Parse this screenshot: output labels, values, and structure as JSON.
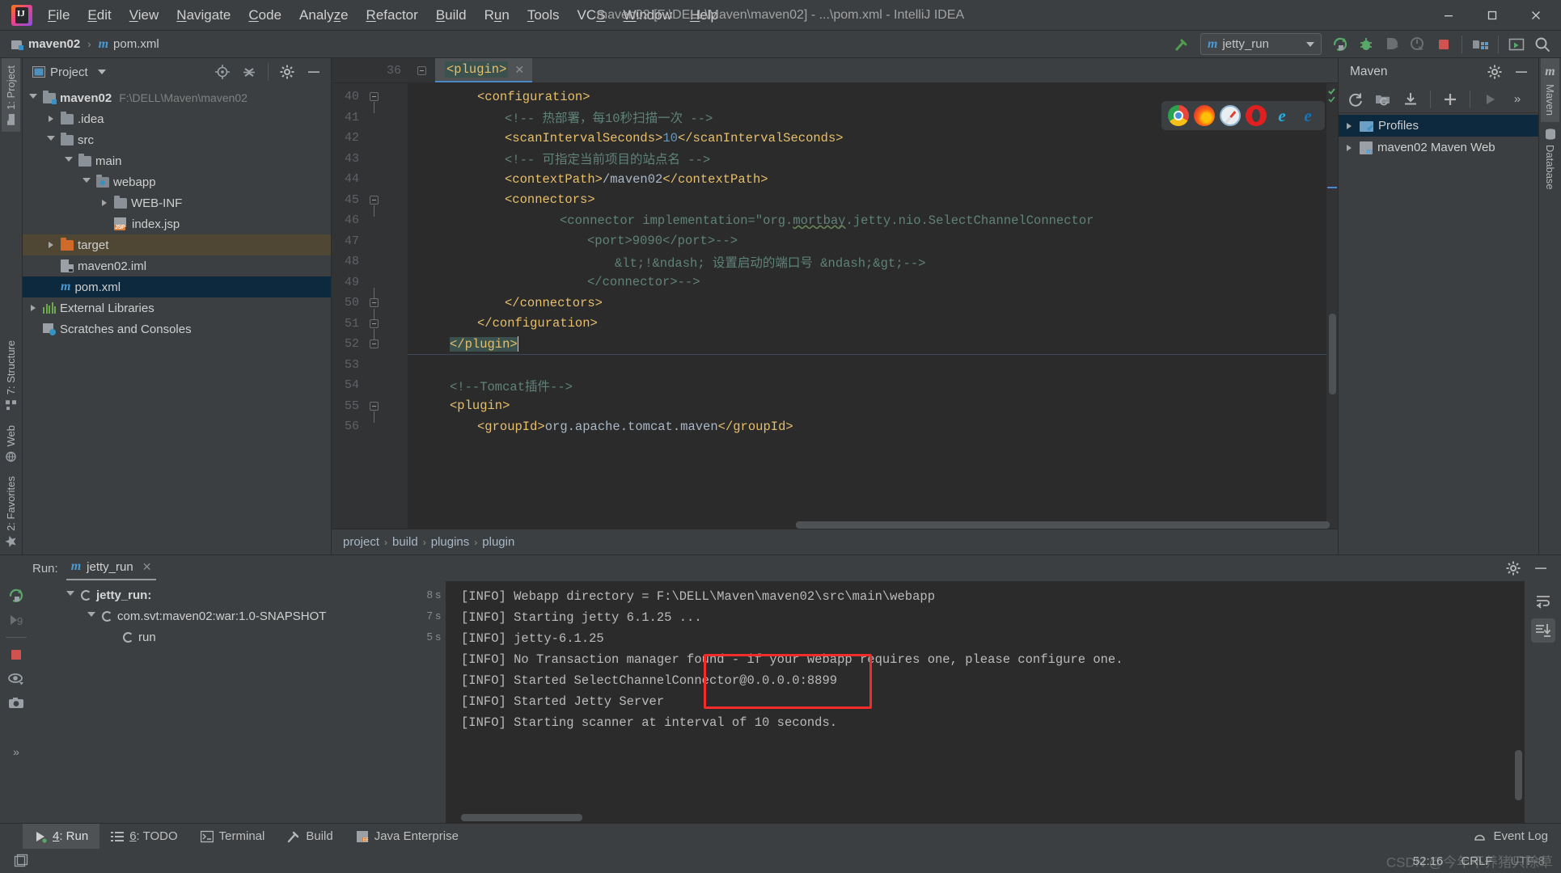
{
  "window": {
    "title": "maven02 [F:\\DELL\\Maven\\maven02] - ...\\pom.xml - IntelliJ IDEA",
    "minimize": "—",
    "maximize": "❐",
    "close": "✕"
  },
  "menubar": [
    {
      "label": "File",
      "mnemonic": "F"
    },
    {
      "label": "Edit",
      "mnemonic": "E"
    },
    {
      "label": "View",
      "mnemonic": "V"
    },
    {
      "label": "Navigate",
      "mnemonic": "N"
    },
    {
      "label": "Code",
      "mnemonic": "C"
    },
    {
      "label": "Analyze",
      "mnemonic": "z"
    },
    {
      "label": "Refactor",
      "mnemonic": "R"
    },
    {
      "label": "Build",
      "mnemonic": "B"
    },
    {
      "label": "Run",
      "mnemonic": "u"
    },
    {
      "label": "Tools",
      "mnemonic": "T"
    },
    {
      "label": "VCS",
      "mnemonic": "S"
    },
    {
      "label": "Window",
      "mnemonic": "W"
    },
    {
      "label": "Help",
      "mnemonic": "H"
    }
  ],
  "navbar": {
    "project": "maven02",
    "file": "pom.xml",
    "run_config": "jetty_run",
    "icons": [
      "build-hammer-icon",
      "run-icon",
      "debug-icon",
      "run-coverage-icon",
      "profile-icon",
      "stop-icon",
      "project-structure-icon",
      "web-preview-icon",
      "search-everywhere-icon"
    ]
  },
  "left_strip": [
    {
      "label": "1: Project",
      "active": true
    },
    {
      "label": "7: Structure",
      "active": false
    },
    {
      "label": "Web",
      "active": false
    },
    {
      "label": "2: Favorites",
      "active": false
    }
  ],
  "right_strip": [
    {
      "label": "Maven",
      "active": true
    },
    {
      "label": "Database",
      "active": false
    }
  ],
  "project_panel": {
    "title": "Project",
    "tree": [
      {
        "indent": 0,
        "arrow": "open",
        "icon": "module-icon",
        "label": "maven02",
        "bold": true,
        "path": "F:\\DELL\\Maven\\maven02",
        "selected": "none"
      },
      {
        "indent": 1,
        "arrow": "closed",
        "icon": "folder-icon",
        "label": ".idea",
        "bold": false,
        "path": "",
        "selected": "none"
      },
      {
        "indent": 1,
        "arrow": "open",
        "icon": "folder-icon",
        "label": "src",
        "bold": false,
        "path": "",
        "selected": "none"
      },
      {
        "indent": 2,
        "arrow": "open",
        "icon": "folder-icon",
        "label": "main",
        "bold": false,
        "path": "",
        "selected": "none"
      },
      {
        "indent": 3,
        "arrow": "open",
        "icon": "folder-web-icon",
        "label": "webapp",
        "bold": false,
        "path": "",
        "selected": "none"
      },
      {
        "indent": 4,
        "arrow": "closed",
        "icon": "folder-icon",
        "label": "WEB-INF",
        "bold": false,
        "path": "",
        "selected": "none"
      },
      {
        "indent": 4,
        "arrow": "none",
        "icon": "jsp-file-icon",
        "label": "index.jsp",
        "bold": false,
        "path": "",
        "selected": "none"
      },
      {
        "indent": 1,
        "arrow": "closed",
        "icon": "folder-excluded-icon",
        "label": "target",
        "bold": false,
        "path": "",
        "selected": "brown"
      },
      {
        "indent": 1,
        "arrow": "none",
        "icon": "iml-file-icon",
        "label": "maven02.iml",
        "bold": false,
        "path": "",
        "selected": "none"
      },
      {
        "indent": 1,
        "arrow": "none",
        "icon": "maven-file-icon",
        "label": "pom.xml",
        "bold": false,
        "path": "",
        "selected": "blue"
      },
      {
        "indent": 0,
        "arrow": "closed",
        "icon": "libraries-icon",
        "label": "External Libraries",
        "bold": false,
        "path": "",
        "selected": "none"
      },
      {
        "indent": 0,
        "arrow": "none",
        "icon": "scratches-icon",
        "label": "Scratches and Consoles",
        "bold": false,
        "path": "",
        "selected": "none"
      }
    ]
  },
  "editor": {
    "tab": "pom.xml",
    "tab_close": "✕",
    "sticky_line": {
      "number": "36",
      "text": "<plugin>"
    },
    "lines": [
      {
        "num": "40",
        "fold": "open",
        "comment_gutter": "",
        "indent": 4,
        "tokens": [
          {
            "t": "tag",
            "v": "<configuration>"
          }
        ]
      },
      {
        "num": "41",
        "fold": "none",
        "comment_gutter": "",
        "indent": 6,
        "tokens": [
          {
            "t": "cmt",
            "v": "<!-- 热部署，每10秒扫描一次 -->"
          }
        ]
      },
      {
        "num": "42",
        "fold": "none",
        "comment_gutter": "",
        "indent": 6,
        "tokens": [
          {
            "t": "tag",
            "v": "<scanIntervalSeconds>"
          },
          {
            "t": "num",
            "v": "10"
          },
          {
            "t": "tag",
            "v": "</scanIntervalSeconds>"
          }
        ]
      },
      {
        "num": "43",
        "fold": "none",
        "comment_gutter": "",
        "indent": 6,
        "tokens": [
          {
            "t": "cmt",
            "v": "<!-- 可指定当前项目的站点名 -->"
          }
        ]
      },
      {
        "num": "44",
        "fold": "none",
        "comment_gutter": "",
        "indent": 6,
        "tokens": [
          {
            "t": "tag",
            "v": "<contextPath>"
          },
          {
            "t": "text",
            "v": "/maven02"
          },
          {
            "t": "tag",
            "v": "</contextPath>"
          }
        ]
      },
      {
        "num": "45",
        "fold": "open",
        "comment_gutter": "",
        "indent": 6,
        "tokens": [
          {
            "t": "tag",
            "v": "<connectors>"
          }
        ]
      },
      {
        "num": "46",
        "fold": "none",
        "comment_gutter": "<!--",
        "indent": 10,
        "tokens": [
          {
            "t": "cmt",
            "v": "<connector implementation=\"org."
          },
          {
            "t": "cmt-wavy",
            "v": "mortbay"
          },
          {
            "t": "cmt",
            "v": ".jetty.nio.SelectChannelConnector"
          }
        ]
      },
      {
        "num": "47",
        "fold": "none",
        "comment_gutter": "<!--",
        "indent": 12,
        "tokens": [
          {
            "t": "cmt",
            "v": "<port>9090</port>-->"
          }
        ]
      },
      {
        "num": "48",
        "fold": "none",
        "comment_gutter": "<!--",
        "indent": 14,
        "tokens": [
          {
            "t": "cmt",
            "v": "&lt;!&ndash; 设置启动的端口号 &ndash;&gt;-->"
          }
        ]
      },
      {
        "num": "49",
        "fold": "none",
        "comment_gutter": "<!--",
        "indent": 12,
        "tokens": [
          {
            "t": "cmt",
            "v": "</connector>-->"
          }
        ]
      },
      {
        "num": "50",
        "fold": "close",
        "comment_gutter": "",
        "indent": 6,
        "tokens": [
          {
            "t": "tag",
            "v": "</connectors>"
          }
        ]
      },
      {
        "num": "51",
        "fold": "close",
        "comment_gutter": "",
        "indent": 4,
        "tokens": [
          {
            "t": "tag",
            "v": "</configuration>"
          }
        ]
      },
      {
        "num": "52",
        "fold": "close",
        "comment_gutter": "",
        "indent": 2,
        "tokens": [
          {
            "t": "tag-sel",
            "v": "</plugin>"
          },
          {
            "t": "caret",
            "v": ""
          }
        ]
      },
      {
        "num": "53",
        "fold": "none",
        "comment_gutter": "",
        "indent": 0,
        "tokens": []
      },
      {
        "num": "54",
        "fold": "none",
        "comment_gutter": "",
        "indent": 2,
        "tokens": [
          {
            "t": "cmt",
            "v": "<!--Tomcat插件-->"
          }
        ]
      },
      {
        "num": "55",
        "fold": "open",
        "comment_gutter": "",
        "indent": 2,
        "tokens": [
          {
            "t": "tag",
            "v": "<plugin>"
          }
        ]
      },
      {
        "num": "56",
        "fold": "none",
        "comment_gutter": "",
        "indent": 4,
        "tokens": [
          {
            "t": "tag",
            "v": "<groupId>"
          },
          {
            "t": "text",
            "v": "org.apache.tomcat.maven"
          },
          {
            "t": "tag",
            "v": "</groupId>"
          }
        ]
      }
    ],
    "browsers": [
      "chrome-icon",
      "firefox-icon",
      "safari-icon",
      "opera-icon",
      "ie-icon",
      "edge-icon"
    ],
    "breadcrumbs": [
      "project",
      "build",
      "plugins",
      "plugin"
    ],
    "breadcrumb_sep": "›"
  },
  "maven_panel": {
    "title": "Maven",
    "toolbar": [
      "reimport-icon",
      "generate-sources-icon",
      "download-sources-icon",
      "add-icon",
      "run-goal-icon",
      "more-icon"
    ],
    "tree": [
      {
        "label": "Profiles",
        "icon": "profiles-icon",
        "selected": true
      },
      {
        "label": "maven02 Maven Web",
        "icon": "maven-module-icon",
        "selected": false
      }
    ]
  },
  "run_panel": {
    "label": "Run:",
    "tab": "jetty_run",
    "tab_close": "✕",
    "gutter_icons": [
      "rerun-icon",
      "rerun-failed-icon",
      "stop-icon",
      "toggle-visibility-icon",
      "screenshot-icon",
      "expand-more-icon"
    ],
    "right_icons": [
      "settings-icon",
      "hide-icon",
      "soft-wrap-icon",
      "scroll-to-end-icon"
    ],
    "tree": [
      {
        "indent": 0,
        "arrow": "open",
        "label": "jetty_run:",
        "bold": true,
        "time": "8 s"
      },
      {
        "indent": 1,
        "arrow": "open",
        "label": "com.svt:maven02:war:1.0-SNAPSHOT",
        "bold": false,
        "time": "7 s"
      },
      {
        "indent": 2,
        "arrow": "none",
        "label": "run",
        "bold": false,
        "time": "5 s"
      }
    ],
    "console": [
      "[INFO] Webapp directory = F:\\DELL\\Maven\\maven02\\src\\main\\webapp",
      "[INFO] Starting jetty 6.1.25 ...",
      "[INFO] jetty-6.1.25",
      "[INFO] No Transaction manager found - if your webapp requires one, please configure one.",
      "[INFO] Started SelectChannelConnector@0.0.0.0:8899",
      "[INFO] Started Jetty Server",
      "[INFO] Starting scanner at interval of 10 seconds."
    ],
    "highlight_color": "#f42b2b"
  },
  "toolwindow_bar": [
    {
      "label": "4: Run",
      "mnemonic": "4",
      "icon": "run-icon",
      "active": true
    },
    {
      "label": "6: TODO",
      "mnemonic": "6",
      "icon": "todo-icon",
      "active": false
    },
    {
      "label": "Terminal",
      "mnemonic": "",
      "icon": "terminal-icon",
      "active": false
    },
    {
      "label": "Build",
      "mnemonic": "",
      "icon": "build-hammer-icon",
      "active": false
    },
    {
      "label": "Java Enterprise",
      "mnemonic": "",
      "icon": "java-enterprise-icon",
      "active": false
    }
  ],
  "statusbar": {
    "event_log": "Event Log",
    "caret_position": "52:16",
    "line_separator": "CRLF",
    "encoding": "UTF-8",
    "watermark": "CSDN @今年不养猪只除草"
  }
}
